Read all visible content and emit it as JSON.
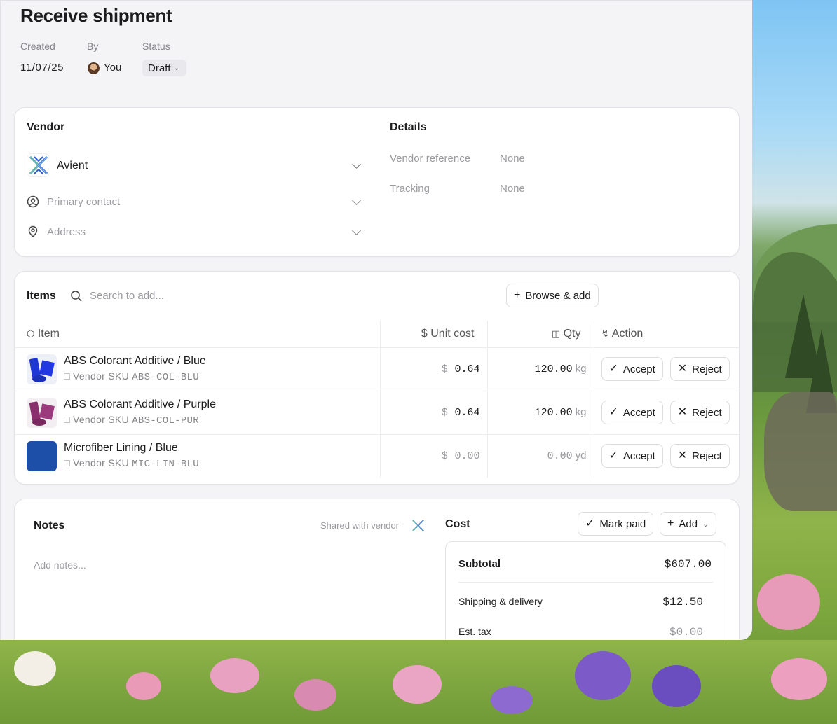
{
  "page": {
    "title": "Receive shipment"
  },
  "meta": {
    "created_label": "Created",
    "created_value": "11/07/25",
    "by_label": "By",
    "by_value": "You",
    "status_label": "Status",
    "status_value": "Draft"
  },
  "vendor": {
    "heading": "Vendor",
    "name": "Avient",
    "primary_contact_placeholder": "Primary contact",
    "address_placeholder": "Address"
  },
  "details": {
    "heading": "Details",
    "vendor_reference_label": "Vendor reference",
    "vendor_reference_value": "None",
    "tracking_label": "Tracking",
    "tracking_value": "None"
  },
  "items": {
    "heading": "Items",
    "search_placeholder": "Search to add...",
    "browse_label": "Browse & add",
    "columns": {
      "item": "Item",
      "unit_cost": "Unit cost",
      "qty": "Qty",
      "action": "Action"
    },
    "accept_label": "Accept",
    "reject_label": "Reject",
    "rows": [
      {
        "name": "ABS Colorant Additive / Blue",
        "sku_label": "Vendor SKU",
        "sku": "ABS-COL-BLU",
        "currency": "$",
        "unit_cost": "0.64",
        "qty": "120.00",
        "unit": "kg",
        "color": "#1f36d6"
      },
      {
        "name": "ABS Colorant Additive / Purple",
        "sku_label": "Vendor SKU",
        "sku": "ABS-COL-PUR",
        "currency": "$",
        "unit_cost": "0.64",
        "qty": "120.00",
        "unit": "kg",
        "color": "#8a2f6e"
      },
      {
        "name": "Microfiber Lining / Blue",
        "sku_label": "Vendor SKU",
        "sku": "MIC-LIN-BLU",
        "currency": "$",
        "unit_cost": "0.00",
        "qty": "0.00",
        "unit": "yd",
        "color": "#1d4fa8"
      }
    ]
  },
  "notes": {
    "heading": "Notes",
    "shared_label": "Shared with vendor",
    "placeholder": "Add notes..."
  },
  "cost": {
    "heading": "Cost",
    "mark_paid_label": "Mark paid",
    "add_label": "Add",
    "subtotal_label": "Subtotal",
    "subtotal_value": "$607.00",
    "shipping_label": "Shipping & delivery",
    "shipping_value": "$12.50",
    "tax_label": "Est. tax",
    "tax_value": "$0.00"
  },
  "colors": {
    "accent_blue": "#2a5bd7",
    "accent_green": "#3aa86b"
  }
}
